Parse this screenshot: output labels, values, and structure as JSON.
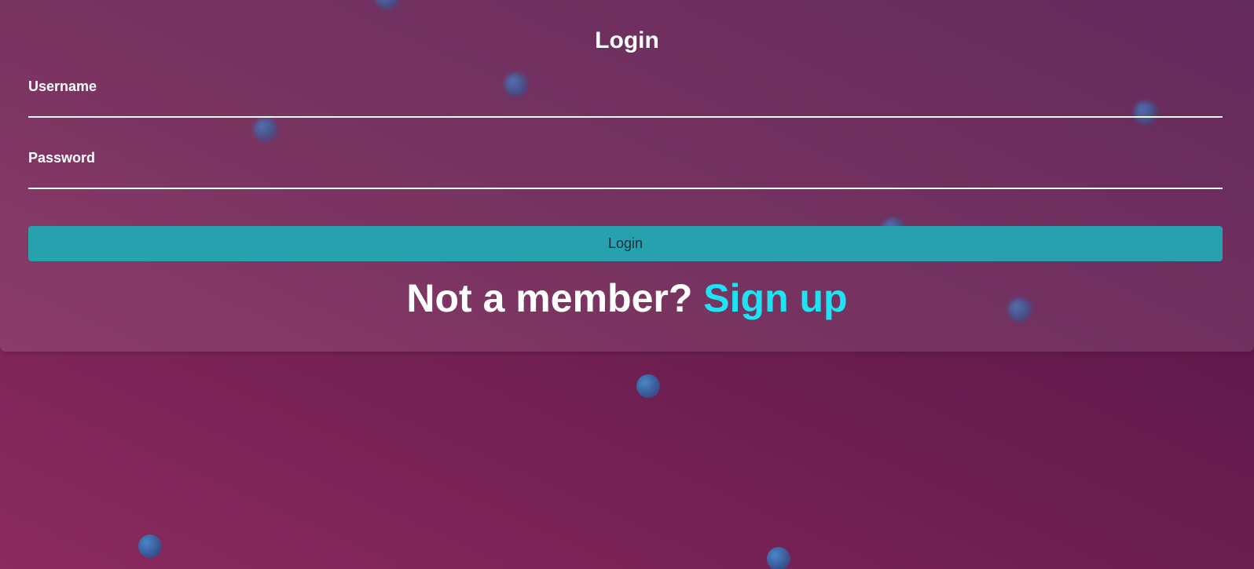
{
  "login_form": {
    "title": "Login",
    "username_label": "Username",
    "username_value": "",
    "password_label": "Password",
    "password_value": "",
    "submit_label": "Login"
  },
  "signup_prompt": {
    "text": "Not a member?",
    "link_label": "Sign up"
  },
  "colors": {
    "background_start": "#8a2a5e",
    "background_end": "#52134a",
    "button": "#27a1ae",
    "link": "#1de3f2"
  }
}
